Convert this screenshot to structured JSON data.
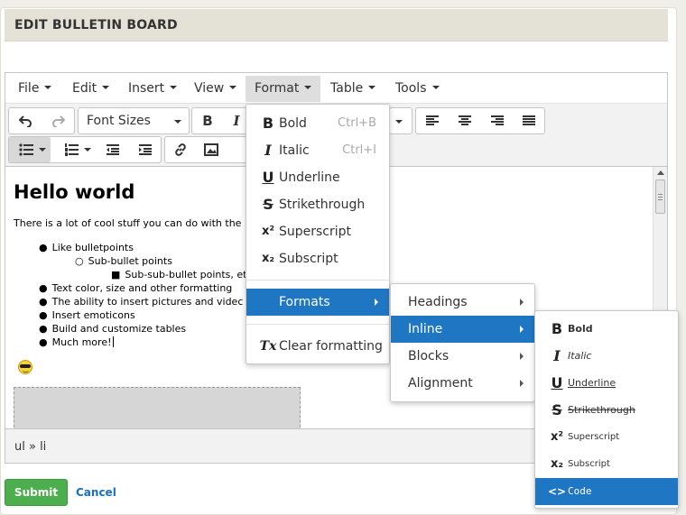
{
  "panel": {
    "title": "EDIT BULLETIN BOARD"
  },
  "menubar": [
    "File",
    "Edit",
    "Insert",
    "View",
    "Format",
    "Table",
    "Tools"
  ],
  "toolbar": {
    "font_sizes": "Font Sizes"
  },
  "content": {
    "heading": "Hello world",
    "paragraph": "There is a lot of cool stuff you can do with the",
    "list": [
      {
        "level": 1,
        "text": "Like bulletpoints"
      },
      {
        "level": 2,
        "text": "Sub-bullet points"
      },
      {
        "level": 3,
        "text": "Sub-sub-bullet points, et"
      },
      {
        "level": 1,
        "text": "Text color, size and other formatting"
      },
      {
        "level": 1,
        "text": "The ability to insert pictures and videc"
      },
      {
        "level": 1,
        "text": "Insert emoticons"
      },
      {
        "level": 1,
        "text": "Build and customize tables"
      },
      {
        "level": 1,
        "text": "Much more!"
      }
    ]
  },
  "statusbar": {
    "path": "ul » li"
  },
  "actions": {
    "submit": "Submit",
    "cancel": "Cancel"
  },
  "format_menu": [
    {
      "icon": "B",
      "label": "Bold",
      "shortcut": "Ctrl+B"
    },
    {
      "icon": "I",
      "label": "Italic",
      "shortcut": "Ctrl+I"
    },
    {
      "icon": "U",
      "label": "Underline",
      "shortcut": ""
    },
    {
      "icon": "S",
      "label": "Strikethrough",
      "shortcut": ""
    },
    {
      "icon": "x²",
      "label": "Superscript",
      "shortcut": ""
    },
    {
      "icon": "x₂",
      "label": "Subscript",
      "shortcut": ""
    },
    {
      "icon": "",
      "label": "Formats",
      "shortcut": "",
      "submenu": true
    },
    {
      "icon": "Tx",
      "label": "Clear formatting",
      "shortcut": ""
    }
  ],
  "formats_menu": [
    "Headings",
    "Inline",
    "Blocks",
    "Alignment"
  ],
  "inline_menu": [
    {
      "icon": "B",
      "label": "Bold"
    },
    {
      "icon": "I",
      "label": "Italic"
    },
    {
      "icon": "U",
      "label": "Underline"
    },
    {
      "icon": "S",
      "label": "Strikethrough"
    },
    {
      "icon": "x²",
      "label": "Superscript"
    },
    {
      "icon": "x₂",
      "label": "Subscript"
    },
    {
      "icon": "<>",
      "label": "Code"
    }
  ],
  "colors": {
    "accent": "#1f77c4",
    "submit": "#4cae4c",
    "header": "#e4e1d6",
    "link": "#1a6fb8"
  }
}
